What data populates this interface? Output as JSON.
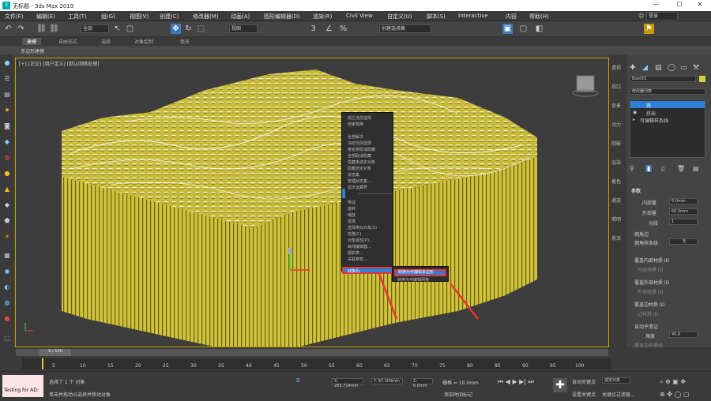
{
  "window": {
    "title": "无标题 - 3ds Max 2019",
    "minimize": "—",
    "maximize": "☐",
    "close": "✕"
  },
  "menus": [
    "文件(F)",
    "编辑(E)",
    "工具(T)",
    "组(G)",
    "视图(V)",
    "创建(C)",
    "修改器(M)",
    "动画(A)",
    "图形编辑器(D)",
    "渲染(R)",
    "Civil View",
    "自定义(U)",
    "脚本(S)",
    "Interactive",
    "内容",
    "帮助(H)"
  ],
  "login": "登录",
  "toolbar": {
    "undo": "↶",
    "redo": "↷",
    "link": "⛓",
    "unlink": "⛓",
    "selection_filter": "全部",
    "select": "↖",
    "select_region": "▢",
    "move": "✥",
    "rotate": "↻",
    "scale": "⬚",
    "view_dropdown": "视图",
    "snap_3": "3",
    "snap_angle": "∠",
    "snap_percent": "%",
    "named_selection": "创建选择集",
    "render": "▣"
  },
  "ribbon": {
    "tabs": [
      "建模",
      "自由形式",
      "选择",
      "对象绘制",
      "填充"
    ],
    "active": 0,
    "sub_label": "多边形建模"
  },
  "viewport": {
    "label": "[+] [正交] [用户定义] [默认明暗处理]"
  },
  "context_menu": {
    "items": [
      "孤立当前选择",
      "结束隔离",
      "全部解冻",
      "冻结当前选择",
      "按名称取消隐藏",
      "全部取消隐藏",
      "隐藏未选定对象",
      "隐藏选定对象",
      "状态集",
      "管理状态集...",
      "显示运算符",
      "",
      "移动",
      "旋转",
      "缩放",
      "选择",
      "选择类似对象(S)",
      "克隆(C)",
      "对象属性(P)...",
      "曲线编辑器...",
      "摄影表...",
      "关联参数...",
      "转换为:"
    ],
    "highlight_item": "转换为:"
  },
  "submenu": {
    "items": [
      "转换为可编辑多边形",
      "转换为可编辑网格"
    ],
    "highlight_item": "转换为可编辑多边形"
  },
  "right_strip": [
    "透视",
    "视口",
    "背景",
    "动力",
    "阴影",
    "渲染",
    "着色",
    "通道",
    "照明",
    "景深"
  ],
  "command_panel": {
    "object_name": "Box001",
    "modifier_list": "修改器列表",
    "stack": [
      "壳",
      "挤出",
      "可编辑样条线"
    ],
    "rollout_title": "参数",
    "params": [
      {
        "label": "内部量",
        "value": "0.0mm"
      },
      {
        "label": "外部量",
        "value": "60.0mm"
      },
      {
        "label": "分段",
        "value": "1"
      }
    ],
    "bevel_edges": "倒角边",
    "bevel_spline": "倒角样条线",
    "bevel_none": "无",
    "override_inner": "覆盖内部材质 ID",
    "inner_mat": "内部材质 ID",
    "override_outer": "覆盖外部材质 ID",
    "outer_mat": "外部材质 ID",
    "override_edge": "覆盖边材质 ID",
    "edge_mat": "边材质 ID",
    "auto_smooth": "自动平滑边",
    "angle_label": "角度",
    "angle_value": "45.0",
    "override_smooth": "覆盖边平滑组"
  },
  "timeline": {
    "frame": "0 / 100",
    "ticks": [
      "0",
      "5",
      "10",
      "15",
      "20",
      "25",
      "30",
      "35",
      "40",
      "45",
      "50",
      "55",
      "60",
      "65",
      "70",
      "75",
      "80",
      "85",
      "90",
      "95",
      "100"
    ]
  },
  "status": {
    "maxscript": "Testing for AD:",
    "line1": "选择了 1 个 对象",
    "line2": "单击并拖动以选择并移动对象",
    "x": "X: 265.714mm",
    "y": "Y: 97.309mm",
    "z": "Z: 0.0mm",
    "grid": "栅格 = 10.0mm",
    "add_time_tag": "添加时间标记",
    "auto_key": "自动关键点",
    "selected_object": "选定对象",
    "set_key": "设置关键点",
    "key_filter": "关键点过滤器..."
  },
  "colors": {
    "terrain": "#d8cb3c",
    "selection_blue": "#2f7fd8",
    "annotation_red": "#e33"
  }
}
